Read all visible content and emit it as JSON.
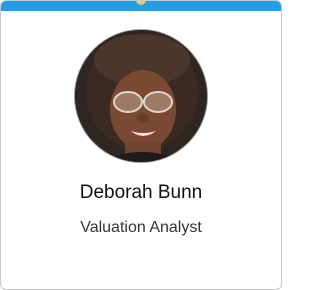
{
  "profile_card": {
    "name": "Deborah Bunn",
    "title": "Valuation Analyst",
    "accent_color": "#1fa0e6",
    "avatar": "profile-photo"
  }
}
